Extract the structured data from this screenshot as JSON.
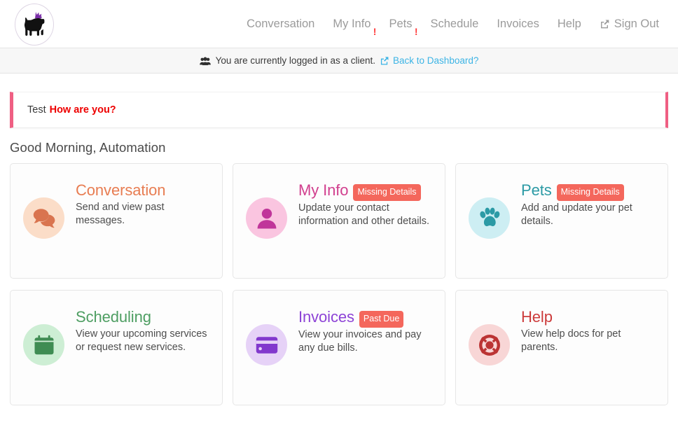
{
  "header": {
    "logo": {
      "icon": "dog-with-crown-logo",
      "crown_color": "#7b2fa8",
      "dog_color": "#111111"
    },
    "nav": [
      {
        "label": "Conversation",
        "alert": "",
        "icon": ""
      },
      {
        "label": "My Info",
        "alert": "!",
        "icon": ""
      },
      {
        "label": "Pets",
        "alert": "!",
        "icon": ""
      },
      {
        "label": "Schedule",
        "alert": "",
        "icon": ""
      },
      {
        "label": "Invoices",
        "alert": "",
        "icon": ""
      },
      {
        "label": "Help",
        "alert": "",
        "icon": ""
      },
      {
        "label": "Sign Out",
        "alert": "",
        "icon": "external-link-icon"
      }
    ]
  },
  "impersonation": {
    "icon": "users-group-icon",
    "text": "You are currently logged in as a client.",
    "link_icon": "external-link-icon",
    "link_label": "Back to Dashboard?",
    "link_color": "#3cb4e5"
  },
  "alert": {
    "label": "Test",
    "message": "How are you?",
    "border_color": "#ef5f83",
    "message_color": "#ee0000"
  },
  "greeting": "Good Morning, Automation",
  "cards": [
    {
      "title": "Conversation",
      "description": "Send and view past messages.",
      "badge": "",
      "title_color": "#e87d52",
      "icon_name": "comments-icon",
      "icon_color": "#d9744f",
      "icon_bg": "#fbddc8"
    },
    {
      "title": "My Info",
      "description": "Update your contact information and other details.",
      "badge": "Missing Details",
      "title_color": "#d13f8e",
      "icon_name": "user-icon",
      "icon_color": "#c0359a",
      "icon_bg": "#fac5e0"
    },
    {
      "title": "Pets",
      "description": "Add and update your pet details.",
      "badge": "Missing Details",
      "title_color": "#2b9aa5",
      "icon_name": "paw-icon",
      "icon_color": "#2b9aa5",
      "icon_bg": "#cdeef3"
    },
    {
      "title": "Scheduling",
      "description": "View your upcoming services or request new services.",
      "badge": "",
      "title_color": "#4e9e62",
      "icon_name": "calendar-icon",
      "icon_color": "#3f8c53",
      "icon_bg": "#cdeed4"
    },
    {
      "title": "Invoices",
      "description": "View your invoices and pay any due bills.",
      "badge": "Past Due",
      "title_color": "#8d43d6",
      "icon_name": "credit-card-icon",
      "icon_color": "#8238cd",
      "icon_bg": "#e6d2f7"
    },
    {
      "title": "Help",
      "description": "View help docs for pet parents.",
      "badge": "",
      "title_color": "#cc3b3b",
      "icon_name": "life-ring-icon",
      "icon_color": "#bb3434",
      "icon_bg": "#f8d6d6"
    }
  ],
  "badge_color": "#f4675c"
}
